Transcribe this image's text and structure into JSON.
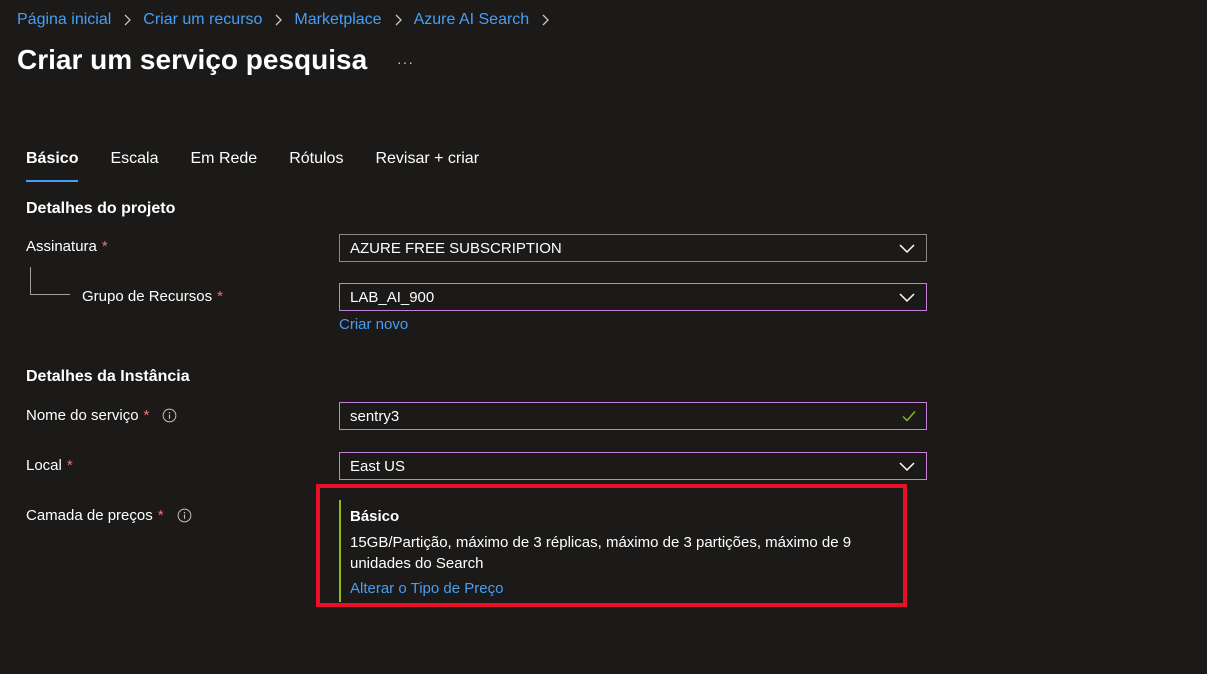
{
  "breadcrumb": {
    "items": [
      "Página inicial",
      "Criar um recurso",
      "Marketplace",
      "Azure AI Search"
    ]
  },
  "page": {
    "title": "Criar um serviço pesquisa",
    "more_label": "···"
  },
  "tabs": [
    {
      "label": "Básico",
      "active": true
    },
    {
      "label": "Escala",
      "active": false
    },
    {
      "label": "Em Rede",
      "active": false
    },
    {
      "label": "Rótulos",
      "active": false
    },
    {
      "label": "Revisar + criar",
      "active": false
    }
  ],
  "project": {
    "section_title": "Detalhes do projeto",
    "subscription_label": "Assinatura",
    "subscription_value": "AZURE FREE SUBSCRIPTION",
    "resource_group_label": "Grupo de Recursos",
    "resource_group_value": "LAB_AI_900",
    "create_new_link": "Criar novo"
  },
  "instance": {
    "section_title": "Detalhes da Instância",
    "service_name_label": "Nome do serviço",
    "service_name_value": "sentry3",
    "location_label": "Local",
    "location_value": "East US",
    "pricing_label": "Camada de preços"
  },
  "pricing": {
    "tier_name": "Básico",
    "description": "15GB/Partição, máximo de 3 réplicas, máximo de 3 partições, máximo de 9 unidades do Search",
    "change_link": "Alterar o Tipo de Preço"
  },
  "required_marker": "*",
  "colors": {
    "background": "#1b1a19",
    "link": "#479ef5",
    "required": "#f1707b",
    "focus_border": "#c57fd8",
    "valid_check": "#8cbd18",
    "highlight": "#e81123"
  }
}
